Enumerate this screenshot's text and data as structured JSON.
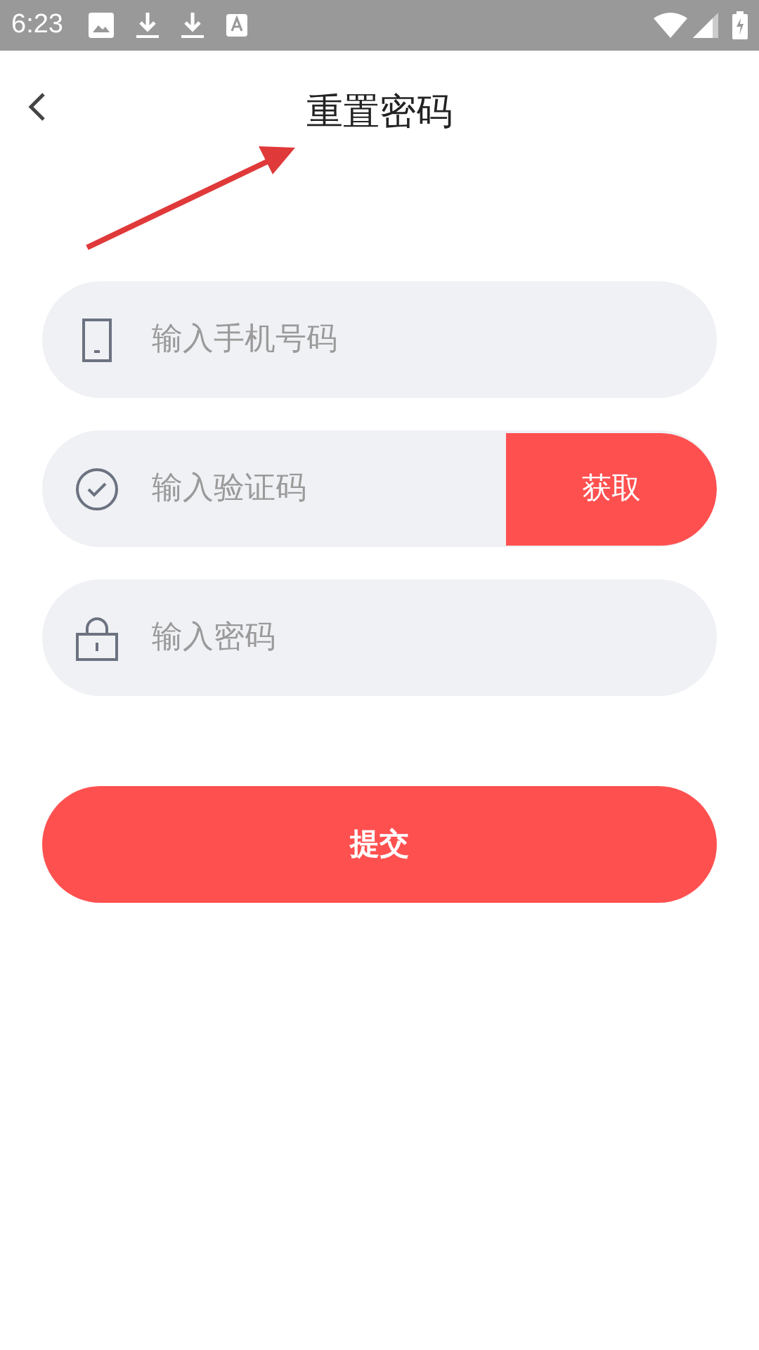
{
  "status_bar": {
    "time": "6:23"
  },
  "header": {
    "title": "重置密码"
  },
  "fields": [
    {
      "kind": "phone",
      "placeholder": "输入手机号码"
    },
    {
      "kind": "code",
      "placeholder": "输入验证码",
      "button": "获取"
    },
    {
      "kind": "password",
      "placeholder": "输入密码"
    }
  ],
  "submit": "提交"
}
